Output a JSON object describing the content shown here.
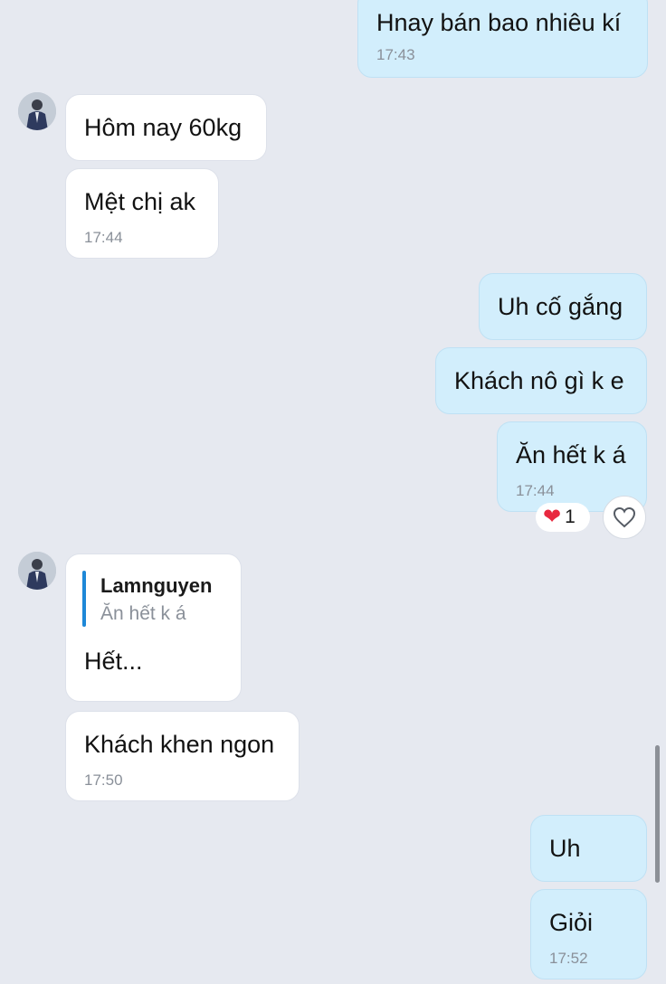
{
  "contact": {
    "name": "Lamnguyen"
  },
  "messages": [
    {
      "text": "Hnay bán bao nhiêu kí",
      "time": "17:43"
    },
    {
      "text": "Hôm nay 60kg"
    },
    {
      "text": "Mệt chị ak",
      "time": "17:44"
    },
    {
      "text": "Uh cố gắng"
    },
    {
      "text": "Khách nô gì k e"
    },
    {
      "text": "Ăn hết k á",
      "time": "17:44",
      "reaction": {
        "emoji": "❤",
        "count": "1"
      }
    },
    {
      "quote": {
        "name": "Lamnguyen",
        "text": "Ăn hết k á"
      },
      "text": "Hết..."
    },
    {
      "text": "Khách khen ngon",
      "time": "17:50"
    },
    {
      "text": "Uh"
    },
    {
      "text": "Giỏi",
      "time": "17:52"
    }
  ],
  "colors": {
    "background": "#e6e9f0",
    "outgoing_bubble": "#d2eefc",
    "incoming_bubble": "#ffffff",
    "quote_accent": "#1e88d8",
    "heart": "#e8283f"
  },
  "icons": {
    "reaction": "heart-icon",
    "like_button": "heart-outline-icon"
  }
}
